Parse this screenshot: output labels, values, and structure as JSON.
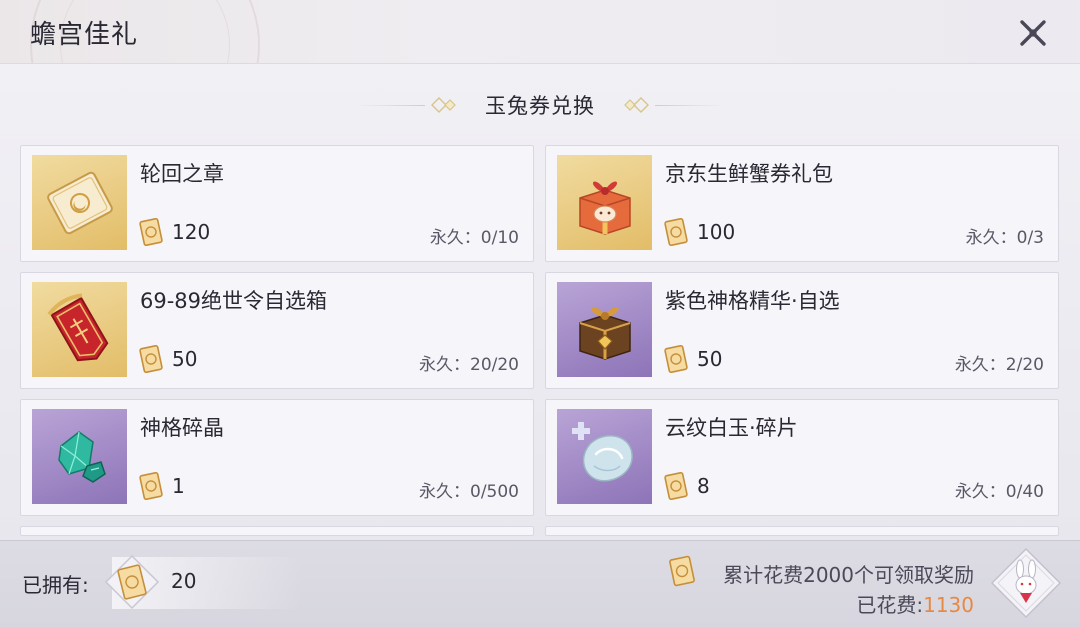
{
  "window": {
    "title": "蟾宫佳礼"
  },
  "section": {
    "title": "玉兔券兑换"
  },
  "items": [
    {
      "name": "轮回之章",
      "cost": "120",
      "limit": "永久：0/10",
      "thumb_bg": "gold",
      "icon": "chapter-scroll-icon"
    },
    {
      "name": "京东生鲜蟹券礼包",
      "cost": "100",
      "limit": "永久：0/3",
      "thumb_bg": "gold",
      "icon": "gift-box-icon"
    },
    {
      "name": "69-89绝世令自选箱",
      "cost": "50",
      "limit": "永久：20/20",
      "thumb_bg": "gold",
      "icon": "red-token-icon"
    },
    {
      "name": "紫色神格精华·自选",
      "cost": "50",
      "limit": "永久：2/20",
      "thumb_bg": "purple",
      "icon": "treasure-chest-icon"
    },
    {
      "name": "神格碎晶",
      "cost": "1",
      "limit": "永久：0/500",
      "thumb_bg": "purple",
      "icon": "green-crystal-icon"
    },
    {
      "name": "云纹白玉·碎片",
      "cost": "8",
      "limit": "永久：0/40",
      "thumb_bg": "purple",
      "icon": "jade-shard-icon"
    }
  ],
  "footer": {
    "owned_label": "已拥有:",
    "owned_count": "20",
    "reward_text": "累计花费2000个可领取奖励",
    "spent_label": "已花费:",
    "spent_value": "1130"
  },
  "colors": {
    "accent_orange": "#e58945",
    "gold_thumb": "#e2bd68",
    "purple_thumb": "#8d74b8",
    "card_bg": "#f6f6fa"
  }
}
